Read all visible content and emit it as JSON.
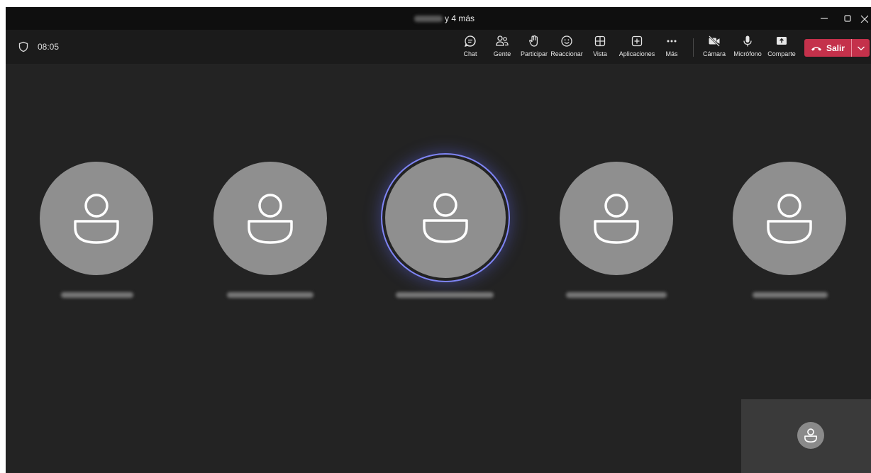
{
  "window": {
    "title_suffix": "y 4 más",
    "controls": {
      "minimize": "—",
      "restore": "❐",
      "close": "✕"
    }
  },
  "toolbar": {
    "timer": "08:05",
    "buttons": [
      {
        "label": "Chat",
        "icon": "chat-icon"
      },
      {
        "label": "Gente",
        "icon": "people-icon"
      },
      {
        "label": "Participar",
        "icon": "raise-hand-icon"
      },
      {
        "label": "Reaccionar",
        "icon": "smiley-icon"
      },
      {
        "label": "Vista",
        "icon": "grid-view-icon"
      },
      {
        "label": "Aplicaciones",
        "icon": "add-app-icon"
      },
      {
        "label": "Más",
        "icon": "more-icon"
      },
      {
        "label": "Cámara",
        "icon": "camera-off-icon"
      },
      {
        "label": "Micrófono",
        "icon": "microphone-icon"
      },
      {
        "label": "Comparte",
        "icon": "share-icon"
      }
    ],
    "leave": {
      "label": "Salir",
      "color": "#c4314b"
    }
  },
  "stage": {
    "participants": [
      {
        "avatar_icon": "person-icon",
        "speaking": false
      },
      {
        "avatar_icon": "person-icon",
        "speaking": false
      },
      {
        "avatar_icon": "person-icon",
        "speaking": true
      },
      {
        "avatar_icon": "person-icon",
        "speaking": false
      },
      {
        "avatar_icon": "person-icon",
        "speaking": false
      }
    ],
    "speaking_ring_color": "#7f85f5",
    "self_view": {
      "avatar_icon": "person-icon"
    }
  },
  "colors": {
    "background": "#232323",
    "toolbar": "#1b1b1b",
    "avatar": "#8f8f8f"
  }
}
